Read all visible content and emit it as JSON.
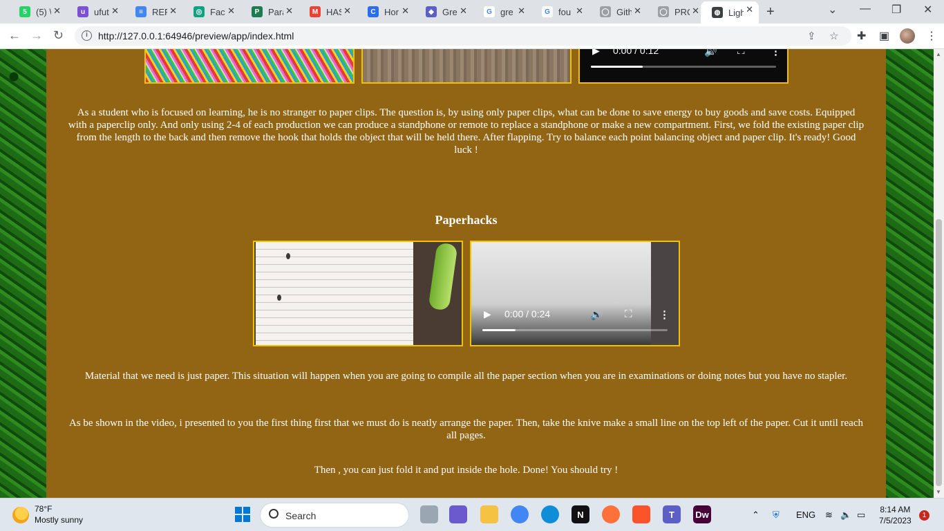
{
  "browser": {
    "tabs": [
      {
        "title": "(5) \\",
        "favicon_color": "#25d366",
        "favicon_text": "5"
      },
      {
        "title": "ufut",
        "favicon_color": "#7b4fd6",
        "favicon_text": "u"
      },
      {
        "title": "REP",
        "favicon_color": "#4285f4",
        "favicon_text": "≡"
      },
      {
        "title": "Faci",
        "favicon_color": "#10a37f",
        "favicon_text": "◎"
      },
      {
        "title": "Para",
        "favicon_color": "#1e7a4f",
        "favicon_text": "P"
      },
      {
        "title": "HAS",
        "favicon_color": "#ea4335",
        "favicon_text": "M"
      },
      {
        "title": "Hor",
        "favicon_color": "#2b6cf0",
        "favicon_text": "C"
      },
      {
        "title": "Gre",
        "favicon_color": "#5b5fc7",
        "favicon_text": "◆"
      },
      {
        "title": "gre",
        "favicon_color": "#ffffff",
        "favicon_text": "G"
      },
      {
        "title": "fou",
        "favicon_color": "#ffffff",
        "favicon_text": "G"
      },
      {
        "title": "Gith",
        "favicon_color": "#9aa0a6",
        "favicon_text": "◯"
      },
      {
        "title": "PRC",
        "favicon_color": "#9aa0a6",
        "favicon_text": "◯"
      },
      {
        "title": "Ligh",
        "favicon_color": "#3c4043",
        "favicon_text": "◍"
      }
    ],
    "new_tab_label": "+",
    "url": "http://127.0.0.1:64946/preview/app/index.html"
  },
  "page": {
    "section1_paragraph": "As a student who is focused on learning, he is no stranger to paper clips. The question is, by using only paper clips, what can be done to save energy to buy goods and save costs. Equipped with a paperclip only. And only using 2-4 of each production we can produce a standphone or remote to replace a standphone or make a new compartment. First, we fold the existing paper clip from the length to the back and then remove the hook that holds the object that will be held there. After flapping. Try to balance each point balancing object and paper clip. It's ready! Good luck !",
    "video1": {
      "time": "0:00 / 0:12",
      "progress": 0.28
    },
    "section2_title": "Paperhacks",
    "video2": {
      "time": "0:00 / 0:24",
      "progress": 0.18
    },
    "paragraph_material": "Material that we need is just paper. This situation will happen when you are going to compile all the paper section when you are in examinations or doing notes but you have no stapler.",
    "paragraph_steps": "As be shown in the video, i presented to you the first thing first that we must do is neatly arrange the paper. Then, take the knive make a small line on the top left of the paper. Cut it until reach all pages.",
    "paragraph_done": "Then , you can just fold it and put inside the hole. Done! You should try !"
  },
  "colors": {
    "content_bg": "#926514",
    "media_border": "#f2c200"
  },
  "taskbar": {
    "temperature": "78°F",
    "weather_desc": "Mostly sunny",
    "search_label": "Search",
    "language": "ENG",
    "time": "8:14 AM",
    "date": "7/5/2023",
    "notification_count": "1",
    "apps": [
      {
        "name": "file-explorer",
        "color": "#f5c242",
        "label": ""
      },
      {
        "name": "chrome",
        "color": "#4285f4",
        "label": ""
      },
      {
        "name": "edge",
        "color": "#0f8dd6",
        "label": ""
      },
      {
        "name": "netflix",
        "color": "#111111",
        "label": "N"
      },
      {
        "name": "firefox",
        "color": "#ff7139",
        "label": ""
      },
      {
        "name": "brave",
        "color": "#fb542b",
        "label": ""
      },
      {
        "name": "teams",
        "color": "#5b5fc7",
        "label": "T"
      },
      {
        "name": "dreamweaver",
        "color": "#470137",
        "label": "Dw"
      }
    ]
  }
}
